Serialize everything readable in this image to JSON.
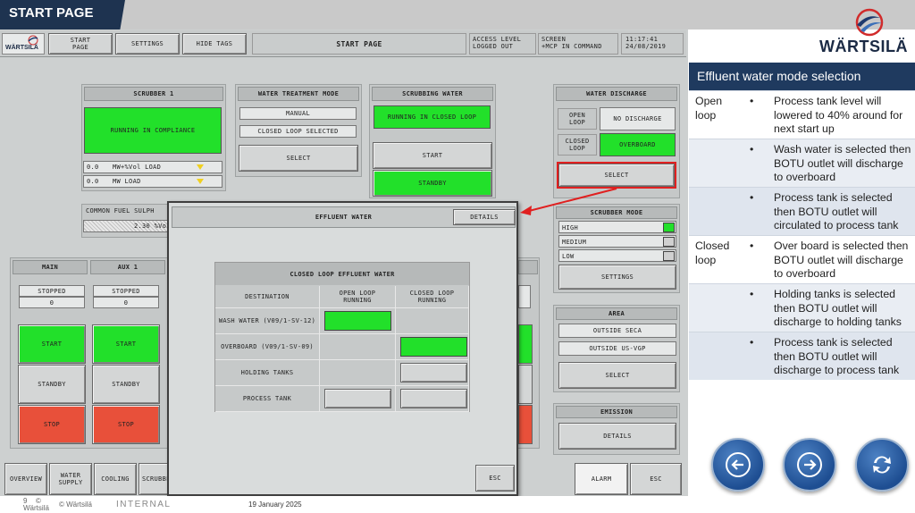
{
  "slide": {
    "title": "START PAGE",
    "brand": "WÄRTSILÄ",
    "footer_page": "9",
    "footer_brand": "Wärtsilä",
    "footer_copyright": "© Wärtsilä",
    "footer_class": "INTERNAL",
    "footer_date": "19 January 2025"
  },
  "hmi_header": {
    "logo": "WÄRTSILÄ",
    "start_page": "START\nPAGE",
    "settings": "SETTINGS",
    "hide_tags": "HIDE TAGS",
    "page_title": "START PAGE",
    "access_label": "ACCESS LEVEL",
    "access_value": "LOGGED OUT",
    "screen_label": "SCREEN",
    "screen_value": "+MCP IN COMMAND",
    "time": "11:17:41",
    "date": "24/08/2019"
  },
  "scrubber": {
    "title": "SCRUBBER 1",
    "status": "RUNNING IN COMPLIANCE",
    "rows": [
      {
        "value": "0.0",
        "label": "MW+%Vol LOAD"
      },
      {
        "value": "0.0",
        "label": "MW LOAD"
      }
    ]
  },
  "fuel": {
    "label": "COMMON FUEL SULPH",
    "value": "2.30 %Vo"
  },
  "wtm": {
    "title": "WATER TREATMENT MODE",
    "mode": "MANUAL",
    "state": "CLOSED LOOP SELECTED",
    "select": "SELECT"
  },
  "sw": {
    "title": "SCRUBBING WATER",
    "status": "RUNNING IN CLOSED LOOP",
    "start": "START",
    "standby": "STANDBY"
  },
  "wd": {
    "title": "WATER DISCHARGE",
    "open_loop": "OPEN\nLOOP",
    "open_value": "NO DISCHARGE",
    "closed_loop": "CLOSED\nLOOP",
    "closed_value": "OVERBOARD",
    "select": "SELECT"
  },
  "sm": {
    "title": "SCRUBBER MODE",
    "modes": [
      "HIGH",
      "MEDIUM",
      "LOW"
    ],
    "settings": "SETTINGS"
  },
  "area": {
    "title": "AREA",
    "seca": "OUTSIDE SECA",
    "usvgp": "OUTSIDE US-VGP",
    "select": "SELECT"
  },
  "emission": {
    "title": "EMISSION",
    "details": "DETAILS"
  },
  "pumps": [
    {
      "name": "MAIN",
      "status": "STOPPED",
      "value": "0",
      "start": "START",
      "standby": "STANDBY",
      "stop": "STOP"
    },
    {
      "name": "AUX 1",
      "status": "STOPPED",
      "value": "0",
      "start": "START",
      "standby": "STANDBY",
      "stop": "STOP"
    }
  ],
  "bottom_nav": {
    "overview": "OVERVIEW",
    "water_supply": "WATER\nSUPPLY",
    "cooling": "COOLING",
    "scrubber": "SCRUBBER",
    "alarm": "ALARM",
    "esc": "ESC"
  },
  "popup": {
    "title": "EFFLUENT WATER",
    "details": "DETAILS",
    "table_title": "CLOSED LOOP EFFLUENT WATER",
    "col_destination": "DESTINATION",
    "col_open": "OPEN LOOP\nRUNNING",
    "col_closed": "CLOSED LOOP\nRUNNING",
    "rows": [
      {
        "name": "WASH WATER (V09/1-SV-12)",
        "open": "green",
        "closed": "none"
      },
      {
        "name": "OVERBOARD (V09/1-SV-09)",
        "open": "none",
        "closed": "green"
      },
      {
        "name": "HOLDING TANKS",
        "open": "none",
        "closed": "gray"
      },
      {
        "name": "PROCESS TANK",
        "open": "gray",
        "closed": "gray"
      }
    ],
    "esc": "ESC"
  },
  "side_panel": {
    "title": "Effluent water mode selection",
    "rows": [
      {
        "category": "Open\nloop",
        "text": "Process tank level will lowered to 40% around for next start up"
      },
      {
        "category": "",
        "text": "Wash water is selected then BOTU outlet will discharge to overboard"
      },
      {
        "category": "",
        "text": "Process tank is selected then BOTU outlet will circulated to process tank"
      },
      {
        "category": "Closed\nloop",
        "text": "Over board is selected then BOTU outlet will discharge to overboard"
      },
      {
        "category": "",
        "text": "Holding tanks is selected then BOTU outlet will discharge to holding tanks"
      },
      {
        "category": "",
        "text": "Process tank is selected then BOTU outlet will discharge to process tank"
      }
    ],
    "bullet": "•"
  },
  "nav_buttons": [
    "back-icon",
    "forward-icon",
    "refresh-icon"
  ],
  "colors": {
    "slide_title_bg": "#1e3350",
    "side_header_bg": "#1f3a5f",
    "running_green": "#22e02a",
    "stop_red": "#e8503a",
    "arrow_red": "#e02020",
    "hmi_bg": "#cdd0d0"
  }
}
